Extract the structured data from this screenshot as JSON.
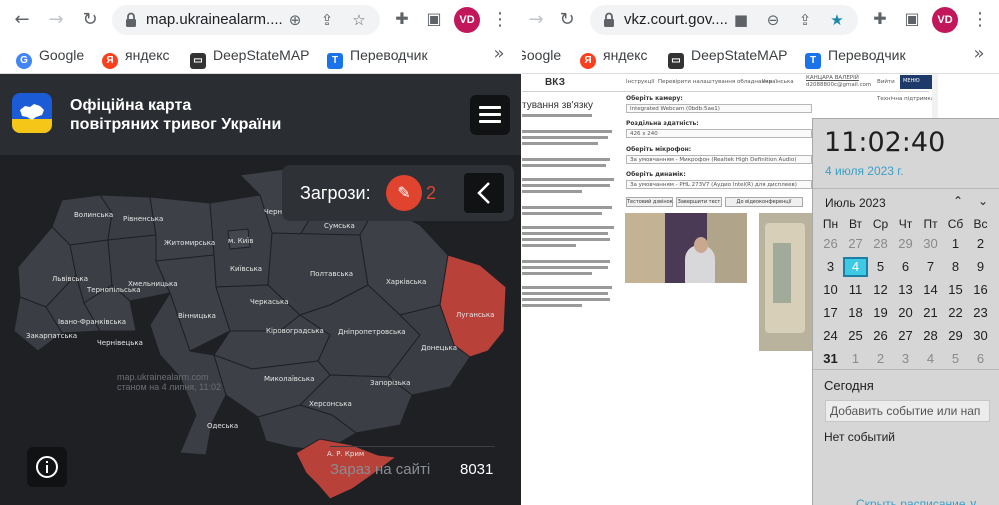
{
  "left_browser": {
    "url": "map.ukrainealarm....",
    "bookmarks": [
      "Google",
      "яндекс",
      "DeepStateMAP",
      "Переводчик"
    ],
    "profile": "VD"
  },
  "right_browser": {
    "url": "vkz.court.gov....",
    "bookmarks": [
      "Google",
      "яндекс",
      "DeepStateMAP",
      "Переводчик"
    ],
    "profile": "VD"
  },
  "alarm_map": {
    "title_line1": "Офіційна карта",
    "title_line2": "повітряних тривог України",
    "threats_label": "Загрози:",
    "threats_count": "2",
    "watermark_line1": "map.ukrainealarm.com",
    "watermark_line2": "станом на 4 липня, 11:02",
    "online_label": "Зараз на сайті",
    "online_count": "8031",
    "regions": [
      "Волинська",
      "Рівненська",
      "Житомирська",
      "м. Київ",
      "Чернігівська",
      "Сумська",
      "Львівська",
      "Тернопільська",
      "Хмельницька",
      "Київська",
      "Полтавська",
      "Харківська",
      "Івано-Франківська",
      "Закарпатська",
      "Чернівецька",
      "Вінницька",
      "Черкаська",
      "Кіровоградська",
      "Дніпропетровська",
      "Луганська",
      "Донецька",
      "Миколаївська",
      "Запорізька",
      "Херсонська",
      "Одеська",
      "А. Р. Крим"
    ],
    "alert_regions": [
      "Луганська",
      "А. Р. Крим"
    ],
    "colors": {
      "alert": "#b8413a",
      "region": "#3a3d43",
      "accent": "#e0442f"
    }
  },
  "court_page": {
    "logo": "ВКЗ",
    "nav_items": [
      "Інструкції",
      "Перевірити налаштування обладнання",
      "Українська"
    ],
    "user_name": "КАНЦАРА ВАЛЕРІЙ",
    "user_email": "d2088800c@gmail.com",
    "exit_label": "Вийти",
    "menu_label": "МЕНЮ",
    "support_label": "Технічна підтримка",
    "section_title": "тування зв'язку",
    "fields": [
      {
        "label": "Оберіть камеру:",
        "value": "Integrated Webcam (0bdb:5ae1)"
      },
      {
        "label": "Роздільна здатність:",
        "value": "426 x 240"
      },
      {
        "label": "Оберіть мікрофон:",
        "value": "За умовчанням - Микрофон (Realtek High Definition Audio)"
      },
      {
        "label": "Оберіть динамік:",
        "value": "За умовчанням - PHL 273V7 (Аудио Intel(R) для дисплеев)"
      }
    ],
    "buttons": [
      "Тестовий дзвінок",
      "Завершити тест",
      "До відеоконференції"
    ]
  },
  "calendar_flyout": {
    "time": "11:02:40",
    "date": "4 июля 2023 г.",
    "month_label": "Июль 2023",
    "weekdays": [
      "Пн",
      "Вт",
      "Ср",
      "Чт",
      "Пт",
      "Сб",
      "Вс"
    ],
    "weeks": [
      [
        "26",
        "27",
        "28",
        "29",
        "30",
        "1",
        "2"
      ],
      [
        "3",
        "4",
        "5",
        "6",
        "7",
        "8",
        "9"
      ],
      [
        "10",
        "11",
        "12",
        "13",
        "14",
        "15",
        "16"
      ],
      [
        "17",
        "18",
        "19",
        "20",
        "21",
        "22",
        "23"
      ],
      [
        "24",
        "25",
        "26",
        "27",
        "28",
        "29",
        "30"
      ],
      [
        "31",
        "1",
        "2",
        "3",
        "4",
        "5",
        "6"
      ]
    ],
    "today_label": "Сегодня",
    "add_event_placeholder": "Добавить событие или нап",
    "no_events": "Нет событий",
    "hide_schedule": "Скрыть расписание ∨",
    "colors": {
      "accent": "#3aa0c7",
      "today": "#3ec9e5"
    }
  }
}
